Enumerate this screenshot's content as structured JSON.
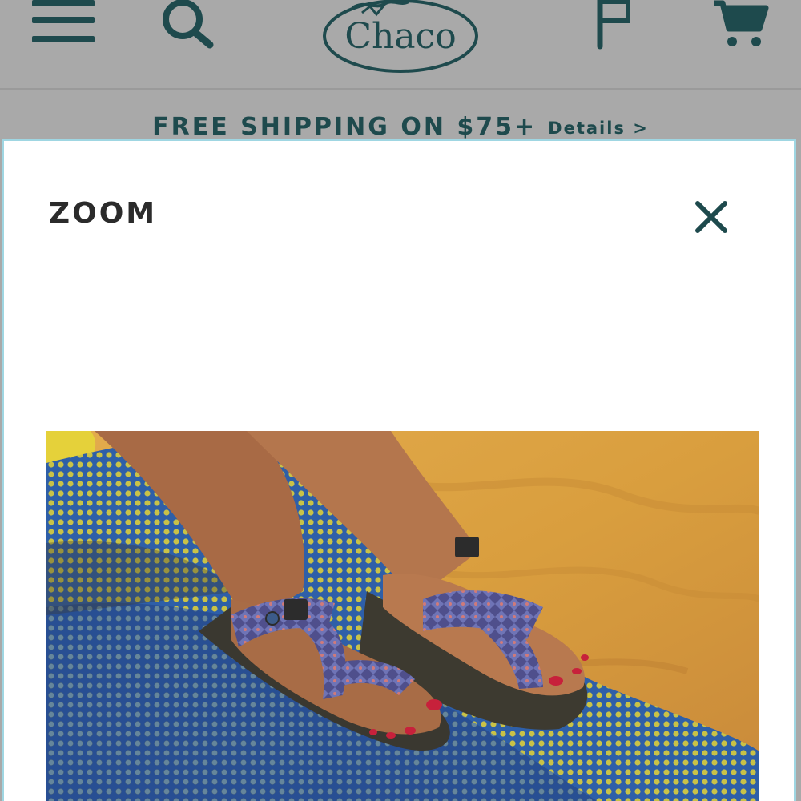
{
  "header": {
    "logo_text": "Chaco",
    "icons": {
      "menu": "hamburger-menu-icon",
      "search": "search-icon",
      "flag": "flag-icon",
      "cart": "shopping-cart-icon"
    }
  },
  "promo": {
    "main_text": "FREE SHIPPING ON $75+",
    "link_text": "Details >"
  },
  "modal": {
    "title": "ZOOM",
    "close_icon": "close-icon",
    "image_alt": "Feet wearing patterned strappy sandals resting on a yellow and blue mesh pad"
  },
  "colors": {
    "brand_teal": "#1e4a4d",
    "header_bg": "#a9a9a9",
    "modal_border": "#9fd6e2",
    "modal_bg": "#ffffff",
    "title_text": "#2b2b2b"
  }
}
